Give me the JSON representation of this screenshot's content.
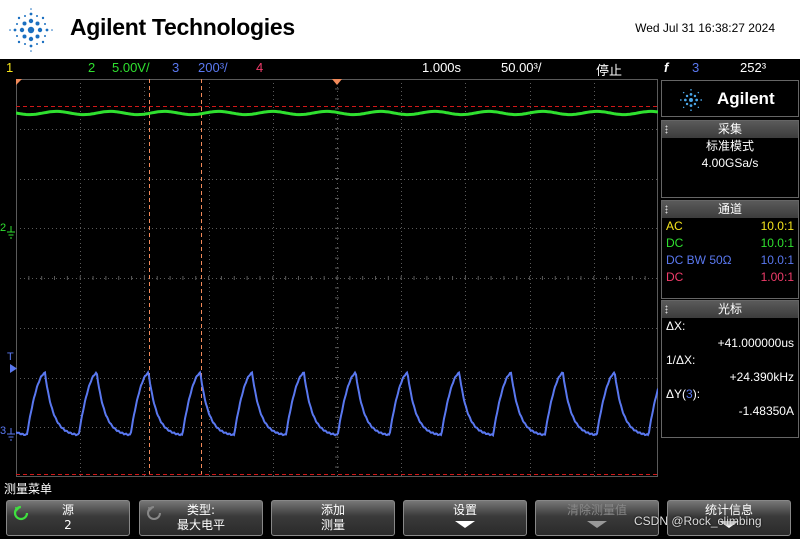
{
  "header": {
    "brand": "Agilent Technologies",
    "datetime": "Wed Jul 31 16:38:27 2024"
  },
  "status": {
    "ch1": "1",
    "ch2": "2",
    "ch2_scale": "5.00V/",
    "ch3": "3",
    "ch3_scale": "200³/",
    "ch4": "4",
    "time_pos": "1.000s",
    "time_scale": "50.00³/",
    "run_state": "停止",
    "trig_icon": "f",
    "trig_ch": "3",
    "trig_level": "252³"
  },
  "colors": {
    "ch1": "#f5e41c",
    "ch2": "#2fe02f",
    "ch3": "#5a78f0",
    "ch4": "#f03c6a",
    "cursor": "#f28a5a",
    "grid": "#5a5a5a"
  },
  "traces": {
    "ch2": "flat trace near top, small ripple",
    "ch3": "periodic triangular wave, 12 peaks visible"
  },
  "markers": {
    "ch2_label": "2",
    "ch3_label": "3",
    "trig_label": "T"
  },
  "panel": {
    "brand": "Agilent",
    "acq_title": "采集",
    "acq_mode": "标准模式",
    "acq_rate": "4.00GSa/s",
    "chan_title": "通道",
    "channels": [
      {
        "coupling": "AC",
        "probe": "10.0:1"
      },
      {
        "coupling": "DC",
        "probe": "10.0:1"
      },
      {
        "coupling": "DC BW 50Ω",
        "probe": "10.0:1"
      },
      {
        "coupling": "DC",
        "probe": "1.00:1"
      }
    ],
    "cursor_title": "光标",
    "dx_label": "ΔX:",
    "dx_value": "+41.000000us",
    "inv_dx_label": "1/ΔX:",
    "inv_dx_value": "+24.390kHz",
    "dy_label_pre": "ΔY(",
    "dy_label_ch": "3",
    "dy_label_post": "):",
    "dy_value": "-1.48350A"
  },
  "softkeys": {
    "title": "测量菜单",
    "source_l1": "源",
    "source_l2": "2",
    "type_l1": "类型:",
    "type_l2": "最大电平",
    "add_l1": "添加",
    "add_l2": "测量",
    "settings_l1": "设置",
    "clear_l1": "清除测量值",
    "stats_l1": "统计信息"
  },
  "watermark": "CSDN @Rock_climbing"
}
